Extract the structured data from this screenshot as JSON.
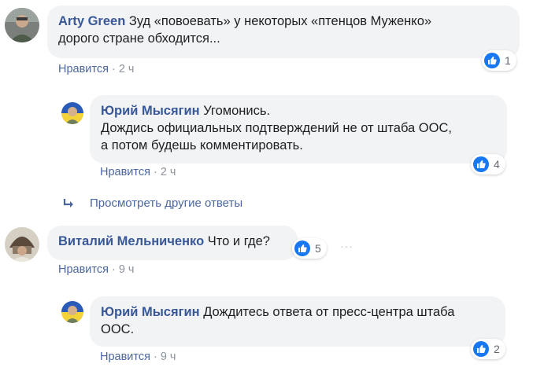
{
  "comments": [
    {
      "author": "Arty Green",
      "text_lines": [
        "Зуд «повоевать» у некоторых «птенцов Муженко»",
        "дорого стране обходится..."
      ],
      "like_label": "Нравится",
      "time": "2 ч",
      "reactions": "1"
    },
    {
      "author": "Юрий Мысягин",
      "text_lines": [
        "Угомонись.",
        "Дождись официальных подтверждений не от штаба ООС,",
        "а потом будешь комментировать."
      ],
      "like_label": "Нравится",
      "time": "2 ч",
      "reactions": "4"
    },
    {
      "author": "Виталий Мельниченко",
      "text_lines": [
        "Что и где?"
      ],
      "like_label": "Нравится",
      "time": "9 ч",
      "reactions": "5"
    },
    {
      "author": "Юрий Мысягин",
      "text_lines": [
        "Дождитесь ответа от пресс-центра штаба",
        "ООС."
      ],
      "like_label": "Нравится",
      "time": "9 ч",
      "reactions": "2"
    }
  ],
  "more_replies_label": "Просмотреть другие ответы",
  "options_label": "···",
  "icons": {
    "like": "thumbs-up-icon",
    "reply_arrow": "reply-arrow-icon"
  },
  "colors": {
    "author": "#385898",
    "like_blue": "#1877f2",
    "bubble_bg": "#f2f3f5",
    "meta": "#8d949e"
  }
}
